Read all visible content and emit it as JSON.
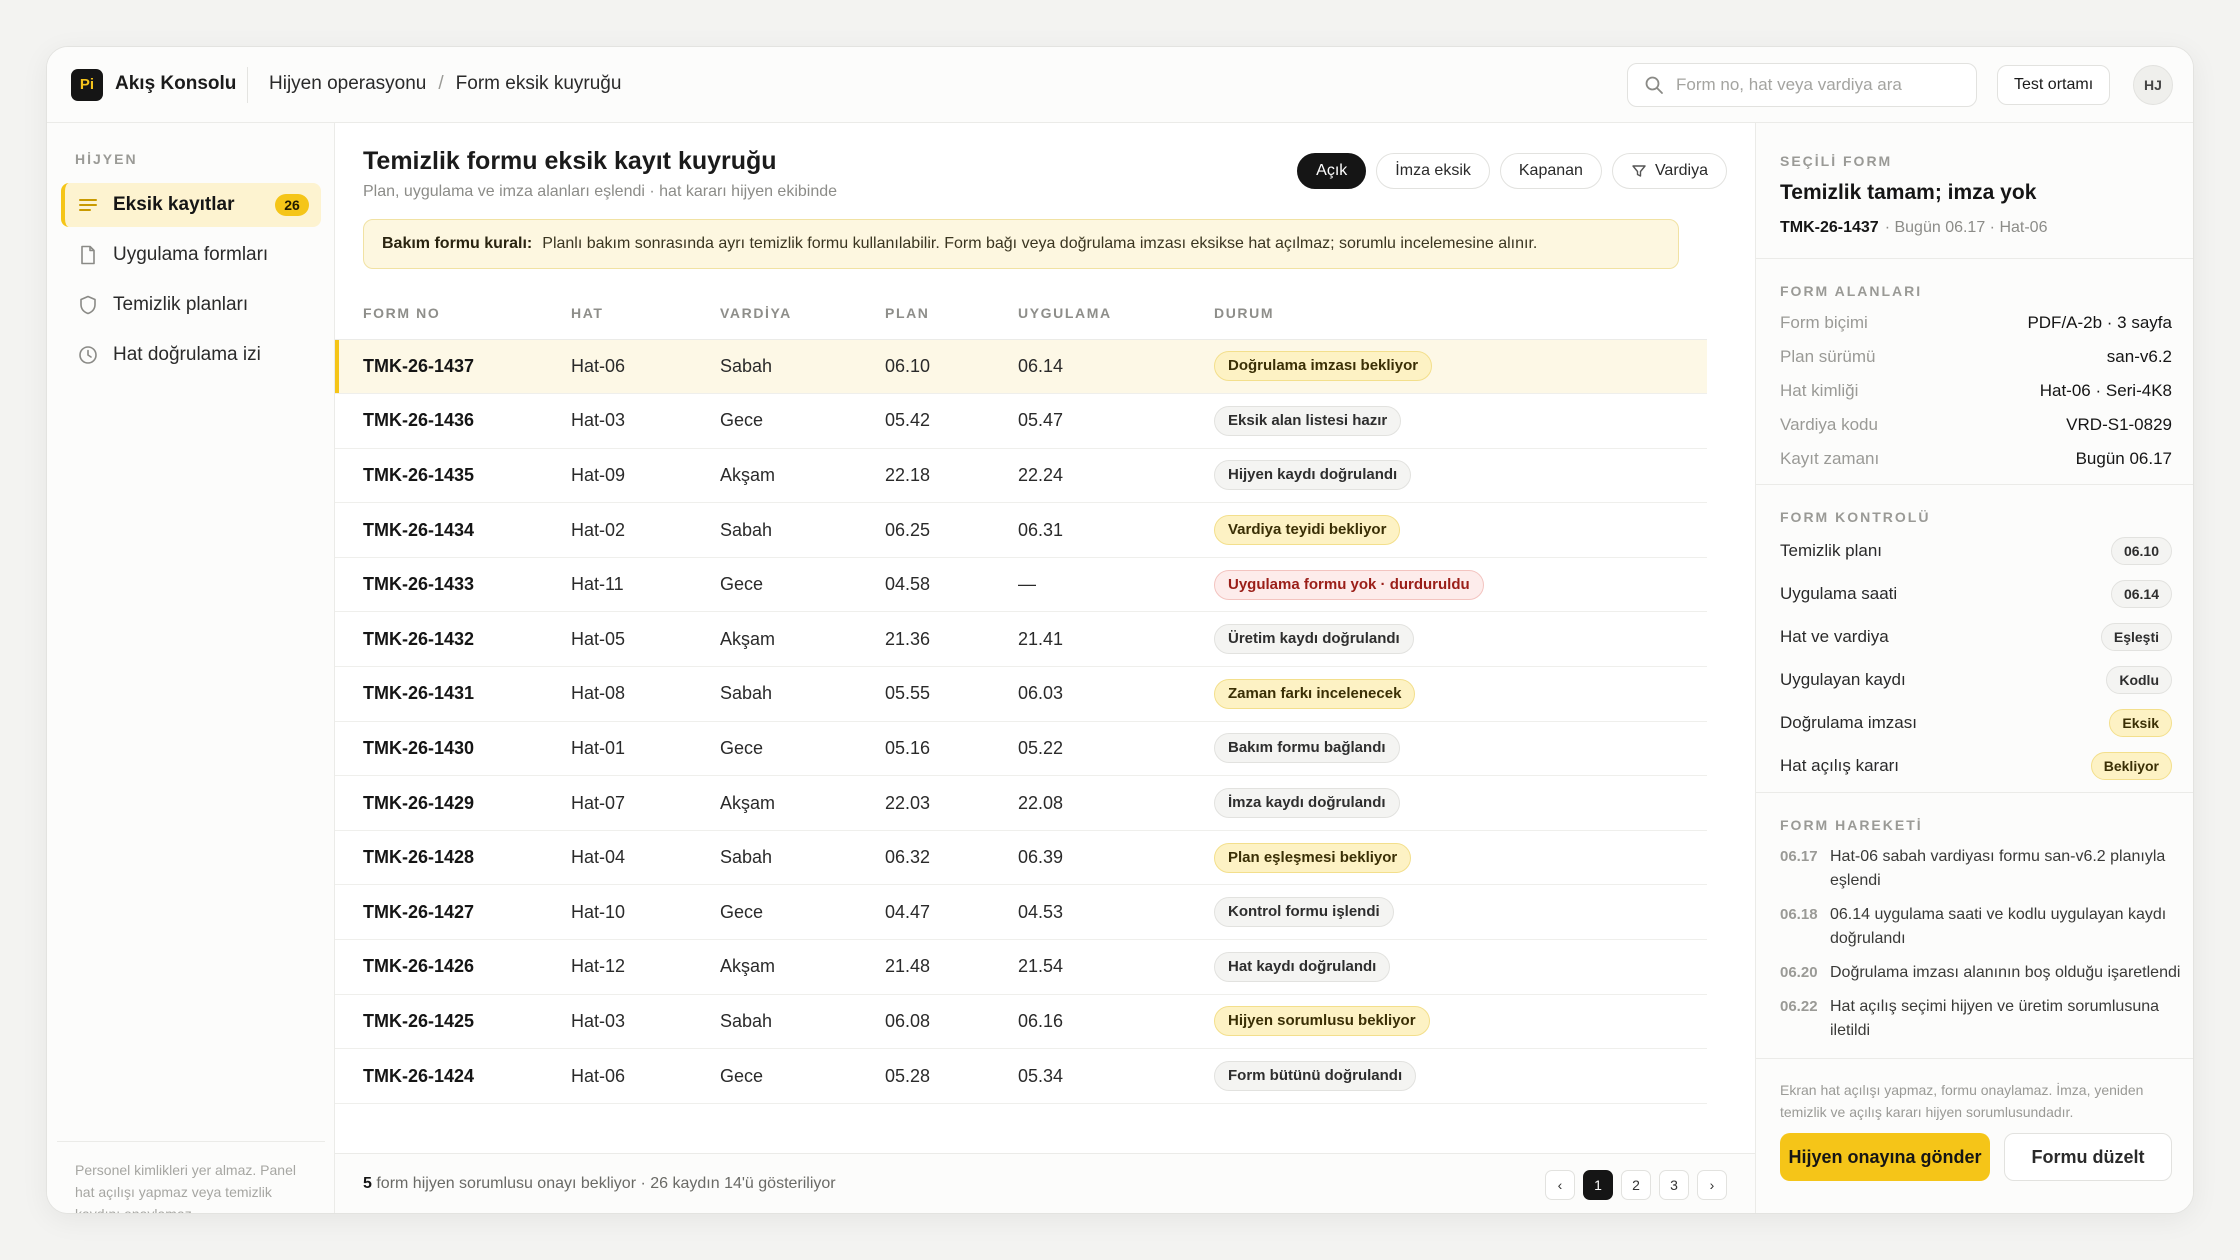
{
  "app": {
    "logo": "Pi",
    "name": "Akış Konsolu"
  },
  "breadcrumb": [
    "Hijyen operasyonu",
    "Form eksik kuyruğu"
  ],
  "search": {
    "placeholder": "Form no, hat veya vardiya ara",
    "value": ""
  },
  "env_label": "Test ortamı",
  "user_initials": "HJ",
  "sidebar": {
    "heading": "HİJYEN",
    "items": [
      {
        "label": "Eksik kayıtlar",
        "badge": "26",
        "icon": "list-icon",
        "active": true
      },
      {
        "label": "Uygulama formları",
        "icon": "document-icon"
      },
      {
        "label": "Temizlik planları",
        "icon": "shield-icon"
      },
      {
        "label": "Hat doğrulama izi",
        "icon": "clock-icon"
      }
    ],
    "footer": "Personel kimlikleri yer almaz. Panel hat açılışı yapmaz veya temizlik kaydını onaylamaz."
  },
  "main": {
    "title": "Temizlik formu eksik kayıt kuyruğu",
    "subtitle": "Plan, uygulama ve imza alanları eşlendi · hat kararı hijyen ekibinde",
    "filters": [
      "Açık",
      "İmza eksik",
      "Kapanan",
      "Vardiya"
    ],
    "rule_label": "Bakım formu kuralı:",
    "rule_text": "Planlı bakım sonrasında ayrı temizlik formu kullanılabilir. Form bağı veya doğrulama imzası eksikse hat açılmaz; sorumlu incelemesine alınır.",
    "columns": [
      "FORM NO",
      "HAT",
      "VARDİYA",
      "PLAN",
      "UYGULAMA",
      "DURUM"
    ],
    "rows": [
      [
        "TMK-26-1437",
        "Hat-06",
        "Sabah",
        "06.10",
        "06.14",
        "Doğrulama imzası bekliyor",
        "warn"
      ],
      [
        "TMK-26-1436",
        "Hat-03",
        "Gece",
        "05.42",
        "05.47",
        "Eksik alan listesi hazır",
        "neutral"
      ],
      [
        "TMK-26-1435",
        "Hat-09",
        "Akşam",
        "22.18",
        "22.24",
        "Hijyen kaydı doğrulandı",
        "neutral"
      ],
      [
        "TMK-26-1434",
        "Hat-02",
        "Sabah",
        "06.25",
        "06.31",
        "Vardiya teyidi bekliyor",
        "warn"
      ],
      [
        "TMK-26-1433",
        "Hat-11",
        "Gece",
        "04.58",
        "—",
        "Uygulama formu yok · durduruldu",
        "err"
      ],
      [
        "TMK-26-1432",
        "Hat-05",
        "Akşam",
        "21.36",
        "21.41",
        "Üretim kaydı doğrulandı",
        "neutral"
      ],
      [
        "TMK-26-1431",
        "Hat-08",
        "Sabah",
        "05.55",
        "06.03",
        "Zaman farkı incelenecek",
        "warn"
      ],
      [
        "TMK-26-1430",
        "Hat-01",
        "Gece",
        "05.16",
        "05.22",
        "Bakım formu bağlandı",
        "neutral"
      ],
      [
        "TMK-26-1429",
        "Hat-07",
        "Akşam",
        "22.03",
        "22.08",
        "İmza kaydı doğrulandı",
        "neutral"
      ],
      [
        "TMK-26-1428",
        "Hat-04",
        "Sabah",
        "06.32",
        "06.39",
        "Plan eşleşmesi bekliyor",
        "warn"
      ],
      [
        "TMK-26-1427",
        "Hat-10",
        "Gece",
        "04.47",
        "04.53",
        "Kontrol formu işlendi",
        "neutral"
      ],
      [
        "TMK-26-1426",
        "Hat-12",
        "Akşam",
        "21.48",
        "21.54",
        "Hat kaydı doğrulandı",
        "neutral"
      ],
      [
        "TMK-26-1425",
        "Hat-03",
        "Sabah",
        "06.08",
        "06.16",
        "Hijyen sorumlusu bekliyor",
        "warn"
      ],
      [
        "TMK-26-1424",
        "Hat-06",
        "Gece",
        "05.28",
        "05.34",
        "Form bütünü doğrulandı",
        "neutral"
      ]
    ],
    "footer_count": "5",
    "footer_text": "form hijyen sorumlusu onayı bekliyor · 26 kaydın 14'ü gösteriliyor",
    "pages": [
      "1",
      "2",
      "3"
    ],
    "prev": "‹",
    "next": "›"
  },
  "panel": {
    "selected_heading": "SEÇİLİ FORM",
    "selected_title": "Temizlik tamam; imza yok",
    "selected_id": "TMK-26-1437",
    "selected_meta": "· Bugün 06.17 · Hat-06",
    "fields_heading": "FORM ALANLARI",
    "fields": [
      {
        "k": "Form biçimi",
        "v": "PDF/A-2b · 3 sayfa"
      },
      {
        "k": "Plan sürümü",
        "v": "san-v6.2"
      },
      {
        "k": "Hat kimliği",
        "v": "Hat-06 · Seri-4K8"
      },
      {
        "k": "Vardiya kodu",
        "v": "VRD-S1-0829"
      },
      {
        "k": "Kayıt zamanı",
        "v": "Bugün 06.17"
      }
    ],
    "control_heading": "FORM KONTROLÜ",
    "controls": [
      {
        "k": "Temizlik planı",
        "v": "06.10",
        "tone": "neutral"
      },
      {
        "k": "Uygulama saati",
        "v": "06.14",
        "tone": "neutral"
      },
      {
        "k": "Hat ve vardiya",
        "v": "Eşleşti",
        "tone": "neutral"
      },
      {
        "k": "Uygulayan kaydı",
        "v": "Kodlu",
        "tone": "neutral"
      },
      {
        "k": "Doğrulama imzası",
        "v": "Eksik",
        "tone": "warn"
      },
      {
        "k": "Hat açılış kararı",
        "v": "Bekliyor",
        "tone": "warn"
      }
    ],
    "history_heading": "FORM HAREKETİ",
    "history": [
      {
        "t": "06.17",
        "text": "Hat-06 sabah vardiyası formu san-v6.2 planıyla eşlendi"
      },
      {
        "t": "06.18",
        "text": "06.14 uygulama saati ve kodlu uygulayan kaydı doğrulandı"
      },
      {
        "t": "06.20",
        "text": "Doğrulama imzası alanının boş olduğu işaretlendi"
      },
      {
        "t": "06.22",
        "text": "Hat açılış seçimi hijyen ve üretim sorumlusuna iletildi"
      }
    ],
    "note": "Ekran hat açılışı yapmaz, formu onaylamaz. İmza, yeniden temizlik ve açılış kararı hijyen sorumlusundadır.",
    "primary_label": "Hijyen onayına gönder",
    "secondary_label": "Formu düzelt"
  },
  "colors": {
    "accent": "#f5c518",
    "dark": "#151515",
    "warn_bg": "#fdf2c4",
    "err_text": "#9a1e18"
  }
}
